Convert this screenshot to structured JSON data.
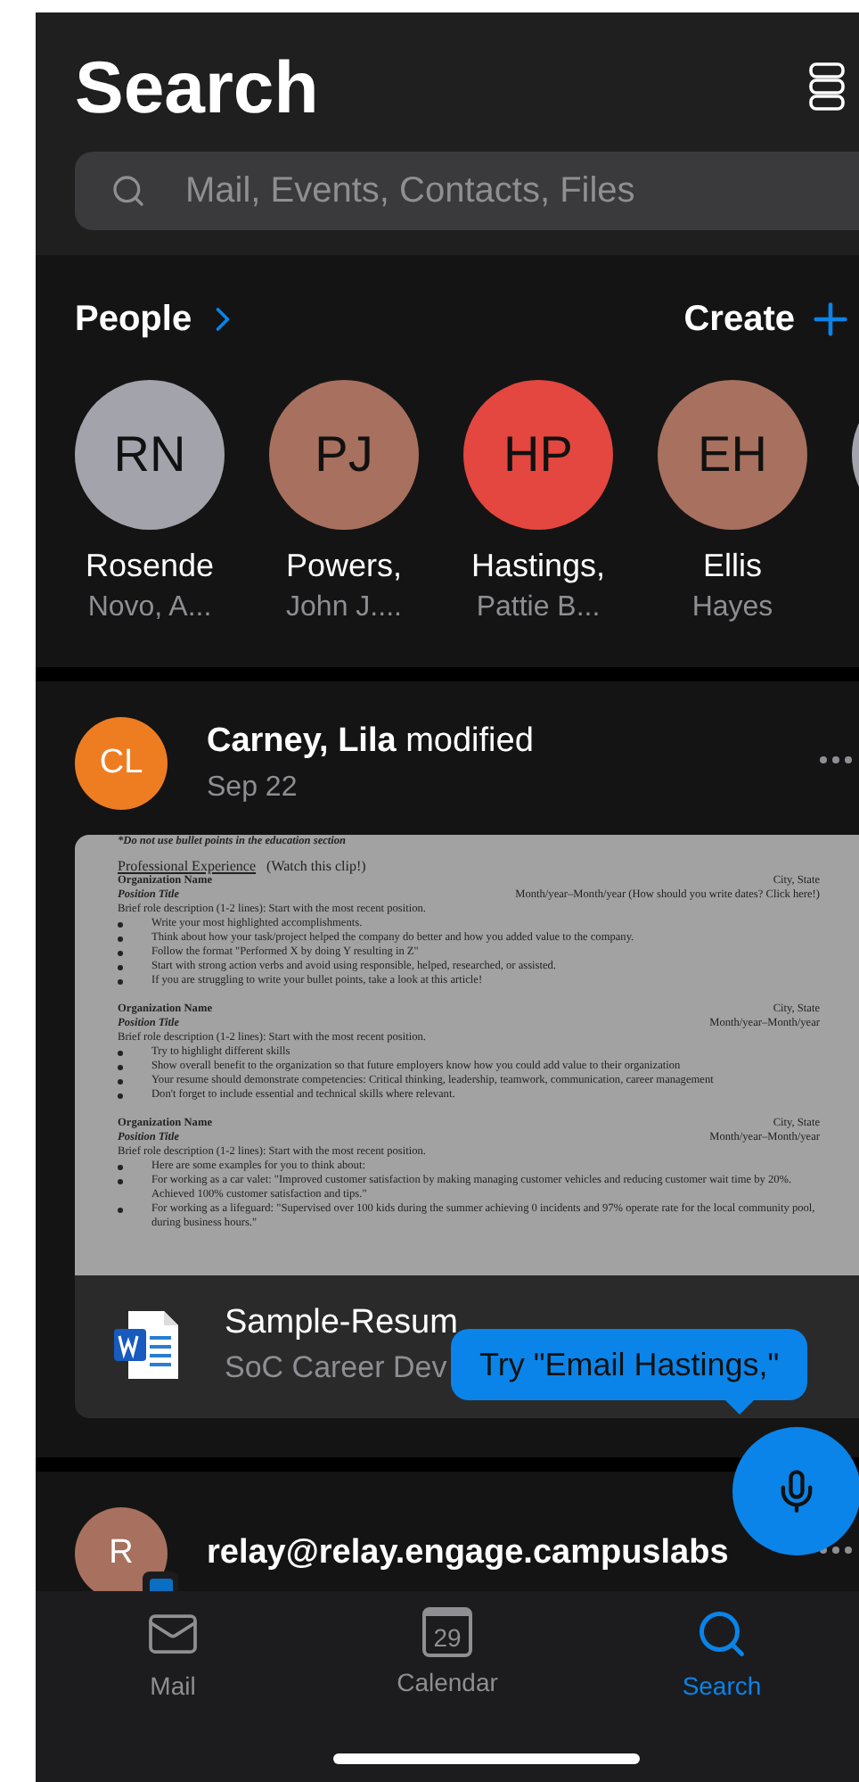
{
  "header": {
    "title": "Search",
    "search": {
      "placeholder": "Mail, Events, Contacts, Files"
    }
  },
  "people": {
    "title": "People",
    "action": "Create",
    "items": [
      {
        "initials": "RN",
        "first": "Rosende",
        "second": "Novo, A...",
        "color": "#a3a3ab"
      },
      {
        "initials": "PJ",
        "first": "Powers,",
        "second": "John J....",
        "color": "#a8705e"
      },
      {
        "initials": "HP",
        "first": "Hastings,",
        "second": "Pattie B...",
        "color": "#e3473f"
      },
      {
        "initials": "EH",
        "first": "Ellis",
        "second": "Hayes",
        "color": "#a8705e"
      },
      {
        "color": "#a3a3ab"
      }
    ]
  },
  "activity": [
    {
      "initials": "CL",
      "color": "#ee7d22",
      "name": "Carney, Lila",
      "action": "modified",
      "date": "Sep 22",
      "badge": false,
      "document": {
        "lines": [
          {
            "kind": "note",
            "text": "*Do not use bullet points in the education section"
          },
          {
            "kind": "heading",
            "text": "Professional Experience",
            "extra": "(Watch this clip!)"
          },
          {
            "kind": "org",
            "left": "Organization Name",
            "right": "City, State"
          },
          {
            "kind": "position",
            "left": "Position Title",
            "right": "Month/year–Month/year (How should you write dates? Click here!)"
          },
          {
            "kind": "para",
            "text": "Brief role description (1-2 lines): Start with the most recent position."
          },
          {
            "kind": "bullet",
            "text": "Write your most highlighted accomplishments."
          },
          {
            "kind": "bullet",
            "text": "Think about how your task/project helped the company do better and how you added value to the company."
          },
          {
            "kind": "bullet",
            "text": "Follow the format \"Performed X by doing Y resulting in Z\""
          },
          {
            "kind": "bullet",
            "text": "Start with strong action verbs and avoid using responsible, helped, researched, or assisted."
          },
          {
            "kind": "bullet",
            "text": "If you are struggling to write your bullet points, take a look at this article!"
          },
          {
            "kind": "org",
            "left": "Organization Name",
            "right": "City, State"
          },
          {
            "kind": "position",
            "left": "Position Title",
            "right": "Month/year–Month/year"
          },
          {
            "kind": "para",
            "text": "Brief role description (1-2 lines): Start with the most recent position."
          },
          {
            "kind": "bullet",
            "text": "Try to highlight different skills"
          },
          {
            "kind": "bullet",
            "text": "Show overall benefit to the organization so that future employers know how you could add value to their organization"
          },
          {
            "kind": "bullet",
            "text": "Your resume should demonstrate competencies: Critical thinking, leadership, teamwork, communication, career management"
          },
          {
            "kind": "bullet",
            "text": "Don't forget to include essential and technical skills where relevant."
          },
          {
            "kind": "org",
            "left": "Organization Name",
            "right": "City, State"
          },
          {
            "kind": "position",
            "left": "Position Title",
            "right": "Month/year–Month/year"
          },
          {
            "kind": "para",
            "text": "Brief role description (1-2 lines): Start with the most recent position."
          },
          {
            "kind": "bullet",
            "text": "Here are some examples for you to think about:"
          },
          {
            "kind": "bullet",
            "text": "For working as a car valet: \"Improved customer satisfaction by making managing customer vehicles and reducing customer wait time by 20%. Achieved 100% customer satisfaction and tips.\""
          },
          {
            "kind": "bullet",
            "text": "For working as a lifeguard: \"Supervised over 100 kids during the summer achieving 0 incidents and 97% operate rate for the local community pool, during business hours.\""
          }
        ]
      },
      "file": {
        "name": "Sample-Resum",
        "source": "SoC Career Dev"
      }
    },
    {
      "initials": "R",
      "color": "#a8705e",
      "name": "relay@relay.engage.campuslabs",
      "badge": true
    }
  ],
  "tooltip": "Try \"Email Hastings,\"",
  "tabs": [
    {
      "label": "Mail",
      "selected": false
    },
    {
      "label": "Calendar",
      "day": "29",
      "selected": false
    },
    {
      "label": "Search",
      "selected": true
    }
  ]
}
